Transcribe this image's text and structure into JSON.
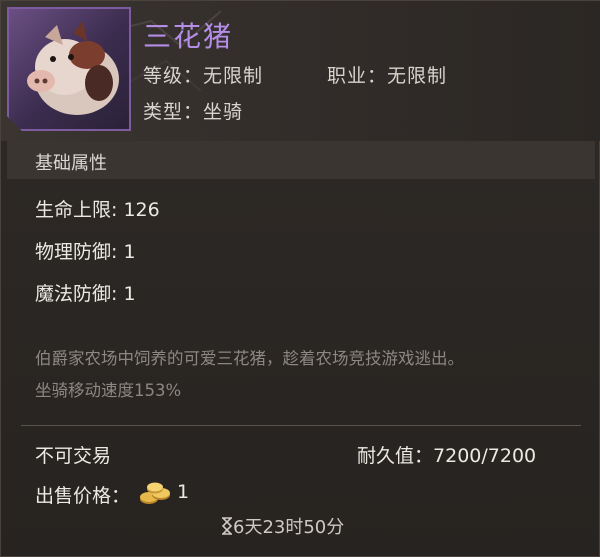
{
  "item": {
    "name": "三花猪",
    "level_label": "等级：",
    "level_value": "无限制",
    "class_label": "职业：",
    "class_value": "无限制",
    "type_label": "类型：",
    "type_value": "坐骑",
    "icon": "pig-icon",
    "name_color": "#b48ee6"
  },
  "basic_attributes": {
    "title": "基础属性",
    "stats": [
      {
        "label": "生命上限:",
        "value": "126"
      },
      {
        "label": "物理防御:",
        "value": "1"
      },
      {
        "label": "魔法防御:",
        "value": "1"
      }
    ]
  },
  "description": {
    "line1": "伯爵家农场中饲养的可爱三花猪，趁着农场竞技游戏逃出。",
    "line2": "坐骑移动速度153%"
  },
  "footer": {
    "trade_status": "不可交易",
    "durability_label": "耐久值：",
    "durability_value": "7200/7200",
    "sell_label": "出售价格：",
    "sell_value": "1",
    "coin_icon": "gold-coin-icon",
    "timer_icon": "hourglass-icon",
    "timer": "6天23时50分"
  }
}
